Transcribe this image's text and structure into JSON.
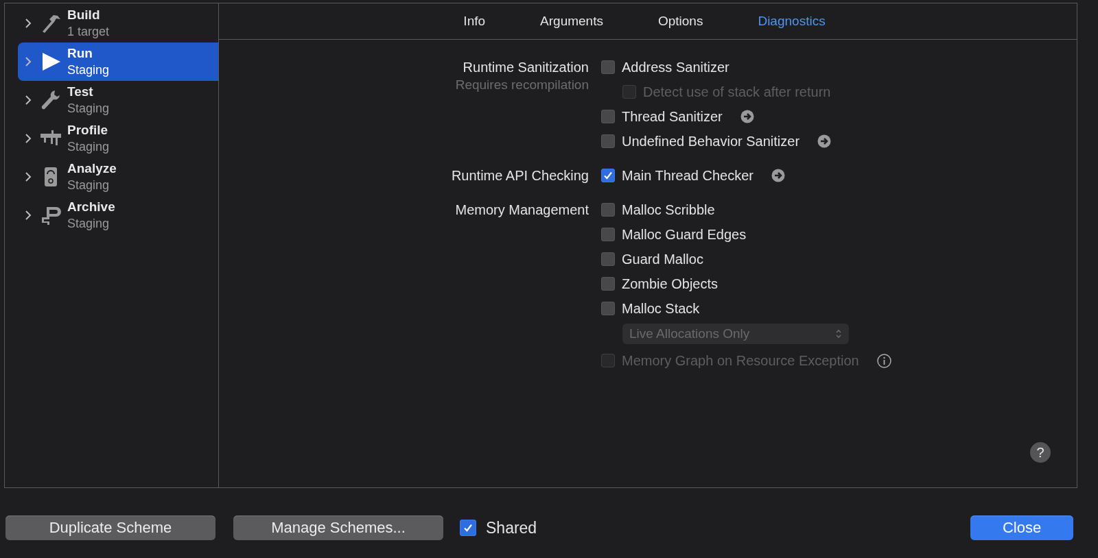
{
  "sidebar": {
    "items": [
      {
        "title": "Build",
        "subtitle": "1 target",
        "kind": "build",
        "selected": false
      },
      {
        "title": "Run",
        "subtitle": "Staging",
        "kind": "run",
        "selected": true
      },
      {
        "title": "Test",
        "subtitle": "Staging",
        "kind": "test",
        "selected": false
      },
      {
        "title": "Profile",
        "subtitle": "Staging",
        "kind": "profile",
        "selected": false
      },
      {
        "title": "Analyze",
        "subtitle": "Staging",
        "kind": "analyze",
        "selected": false
      },
      {
        "title": "Archive",
        "subtitle": "Staging",
        "kind": "archive",
        "selected": false
      }
    ]
  },
  "tabs": [
    {
      "label": "Info",
      "selected": false
    },
    {
      "label": "Arguments",
      "selected": false
    },
    {
      "label": "Options",
      "selected": false
    },
    {
      "label": "Diagnostics",
      "selected": true
    }
  ],
  "sections": [
    {
      "label": "Runtime Sanitization",
      "note": "Requires recompilation",
      "options": [
        {
          "kind": "checkbox",
          "label": "Address Sanitizer",
          "checked": false,
          "disabled": false,
          "children": [
            {
              "kind": "checkbox",
              "label": "Detect use of stack after return",
              "checked": false,
              "disabled": true
            }
          ]
        },
        {
          "kind": "checkbox",
          "label": "Thread Sanitizer",
          "checked": false,
          "disabled": false,
          "arrow": true
        },
        {
          "kind": "checkbox",
          "label": "Undefined Behavior Sanitizer",
          "checked": false,
          "disabled": false,
          "arrow": true
        }
      ]
    },
    {
      "label": "Runtime API Checking",
      "options": [
        {
          "kind": "checkbox",
          "label": "Main Thread Checker",
          "checked": true,
          "disabled": false,
          "arrow": true
        }
      ]
    },
    {
      "label": "Memory Management",
      "options": [
        {
          "kind": "checkbox",
          "label": "Malloc Scribble",
          "checked": false,
          "disabled": false
        },
        {
          "kind": "checkbox",
          "label": "Malloc Guard Edges",
          "checked": false,
          "disabled": false
        },
        {
          "kind": "checkbox",
          "label": "Guard Malloc",
          "checked": false,
          "disabled": false
        },
        {
          "kind": "checkbox",
          "label": "Zombie Objects",
          "checked": false,
          "disabled": false
        },
        {
          "kind": "checkbox",
          "label": "Malloc Stack",
          "checked": false,
          "disabled": false,
          "children": [
            {
              "kind": "popup",
              "value": "Live Allocations Only",
              "disabled": true
            }
          ]
        },
        {
          "kind": "checkbox",
          "label": "Memory Graph on Resource Exception",
          "checked": false,
          "disabled": true,
          "info": true
        }
      ]
    }
  ],
  "help": {
    "label": "?"
  },
  "footer": {
    "buttons": [
      {
        "label": "Duplicate Scheme"
      },
      {
        "label": "Manage Schemes..."
      }
    ],
    "shared": {
      "label": "Shared",
      "checked": true
    },
    "close": {
      "label": "Close"
    }
  }
}
